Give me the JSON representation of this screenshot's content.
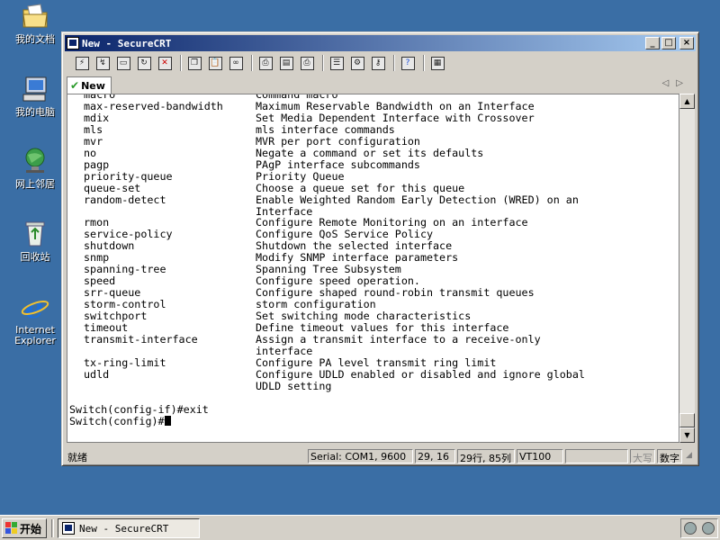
{
  "desktop": {
    "icons": [
      {
        "label": "我的文档"
      },
      {
        "label": "我的电脑"
      },
      {
        "label": "网上邻居"
      },
      {
        "label": "回收站"
      },
      {
        "label": "Internet Explorer",
        "line1": "Internet",
        "line2": "Explorer"
      }
    ]
  },
  "window": {
    "title": "New - SecureCRT",
    "tab_label": "New",
    "controls": {
      "minimize": "_",
      "maximize": "□",
      "close": "×"
    }
  },
  "terminal": {
    "partial_top": {
      "cmd": "macro",
      "desc": "Command macro"
    },
    "rows": [
      {
        "cmd": "max-reserved-bandwidth",
        "desc": "Maximum Reservable Bandwidth on an Interface"
      },
      {
        "cmd": "mdix",
        "desc": "Set Media Dependent Interface with Crossover"
      },
      {
        "cmd": "mls",
        "desc": "mls interface commands"
      },
      {
        "cmd": "mvr",
        "desc": "MVR per port configuration"
      },
      {
        "cmd": "no",
        "desc": "Negate a command or set its defaults"
      },
      {
        "cmd": "pagp",
        "desc": "PAgP interface subcommands"
      },
      {
        "cmd": "priority-queue",
        "desc": "Priority Queue"
      },
      {
        "cmd": "queue-set",
        "desc": "Choose a queue set for this queue"
      },
      {
        "cmd": "random-detect",
        "desc": "Enable Weighted Random Early Detection (WRED) on an"
      },
      {
        "cmd": "",
        "desc": "Interface"
      },
      {
        "cmd": "rmon",
        "desc": "Configure Remote Monitoring on an interface"
      },
      {
        "cmd": "service-policy",
        "desc": "Configure QoS Service Policy"
      },
      {
        "cmd": "shutdown",
        "desc": "Shutdown the selected interface"
      },
      {
        "cmd": "snmp",
        "desc": "Modify SNMP interface parameters"
      },
      {
        "cmd": "spanning-tree",
        "desc": "Spanning Tree Subsystem"
      },
      {
        "cmd": "speed",
        "desc": "Configure speed operation."
      },
      {
        "cmd": "srr-queue",
        "desc": "Configure shaped round-robin transmit queues"
      },
      {
        "cmd": "storm-control",
        "desc": "storm configuration"
      },
      {
        "cmd": "switchport",
        "desc": "Set switching mode characteristics"
      },
      {
        "cmd": "timeout",
        "desc": "Define timeout values for this interface"
      },
      {
        "cmd": "transmit-interface",
        "desc": "Assign a transmit interface to a receive-only"
      },
      {
        "cmd": "",
        "desc": "interface"
      },
      {
        "cmd": "tx-ring-limit",
        "desc": "Configure PA level transmit ring limit"
      },
      {
        "cmd": "udld",
        "desc": "Configure UDLD enabled or disabled and ignore global"
      },
      {
        "cmd": "",
        "desc": "UDLD setting"
      }
    ],
    "prompt_lines": [
      "",
      "Switch(config-if)#exit"
    ],
    "current_prompt": "Switch(config)#"
  },
  "statusbar": {
    "ready": "就绪",
    "connection": "Serial: COM1, 9600",
    "cursor_pos": "29, 16",
    "rows_cols": "29行, 85列",
    "emulation": "VT100",
    "caps": "大写",
    "num": "数字"
  },
  "taskbar": {
    "start_label": "开始",
    "task_label": "New - SecureCRT"
  }
}
